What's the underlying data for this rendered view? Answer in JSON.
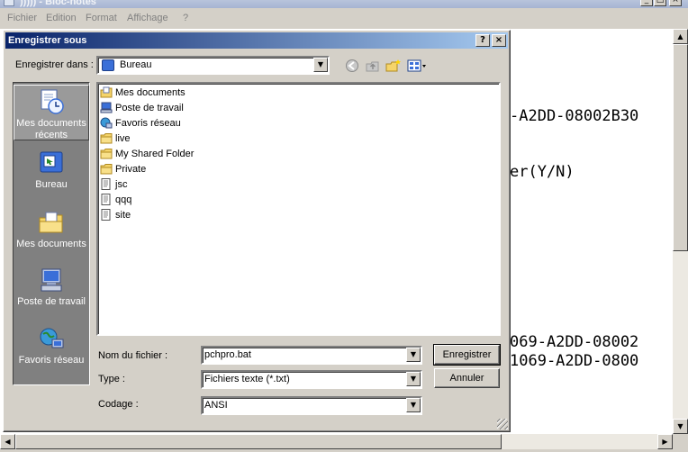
{
  "notepad": {
    "title": "))))) - Bloc-notes",
    "menu": [
      "Fichier",
      "Edition",
      "Format",
      "Affichage",
      "?"
    ],
    "text_lines": [
      "-A2DD-08002B30",
      "er(Y/N)",
      "069-A2DD-08002",
      "1069-A2DD-0800"
    ],
    "window_buttons": {
      "minimize": "_",
      "maximize": "□",
      "close": "×"
    }
  },
  "dialog": {
    "title": "Enregistrer sous",
    "help_label": "?",
    "close_label": "×",
    "save_in_label": "Enregistrer dans :",
    "save_in_value": "Bureau",
    "places": [
      {
        "label": "Mes documents récents",
        "icon": "recent-documents-icon"
      },
      {
        "label": "Bureau",
        "icon": "desktop-icon"
      },
      {
        "label": "Mes documents",
        "icon": "my-documents-icon"
      },
      {
        "label": "Poste de travail",
        "icon": "my-computer-icon"
      },
      {
        "label": "Favoris réseau",
        "icon": "network-places-icon"
      }
    ],
    "files": [
      {
        "name": "Mes documents",
        "icon": "my-documents-icon"
      },
      {
        "name": "Poste de travail",
        "icon": "my-computer-icon"
      },
      {
        "name": "Favoris réseau",
        "icon": "network-places-icon"
      },
      {
        "name": "live",
        "icon": "folder-icon"
      },
      {
        "name": "My Shared Folder",
        "icon": "folder-icon"
      },
      {
        "name": "Private",
        "icon": "folder-icon"
      },
      {
        "name": "jsc",
        "icon": "text-file-icon"
      },
      {
        "name": "qqq",
        "icon": "text-file-icon"
      },
      {
        "name": "site",
        "icon": "text-file-icon"
      }
    ],
    "filename_label": "Nom du fichier :",
    "filename_value": "pchpro.bat",
    "type_label": "Type :",
    "type_value": "Fichiers texte (*.txt)",
    "encoding_label": "Codage :",
    "encoding_value": "ANSI",
    "save_button": "Enregistrer",
    "cancel_button": "Annuler"
  },
  "colors": {
    "dialog_title_start": "#0a246a",
    "dialog_title_end": "#a6caf0",
    "face": "#d4d0c8",
    "places_bar": "#808080"
  }
}
